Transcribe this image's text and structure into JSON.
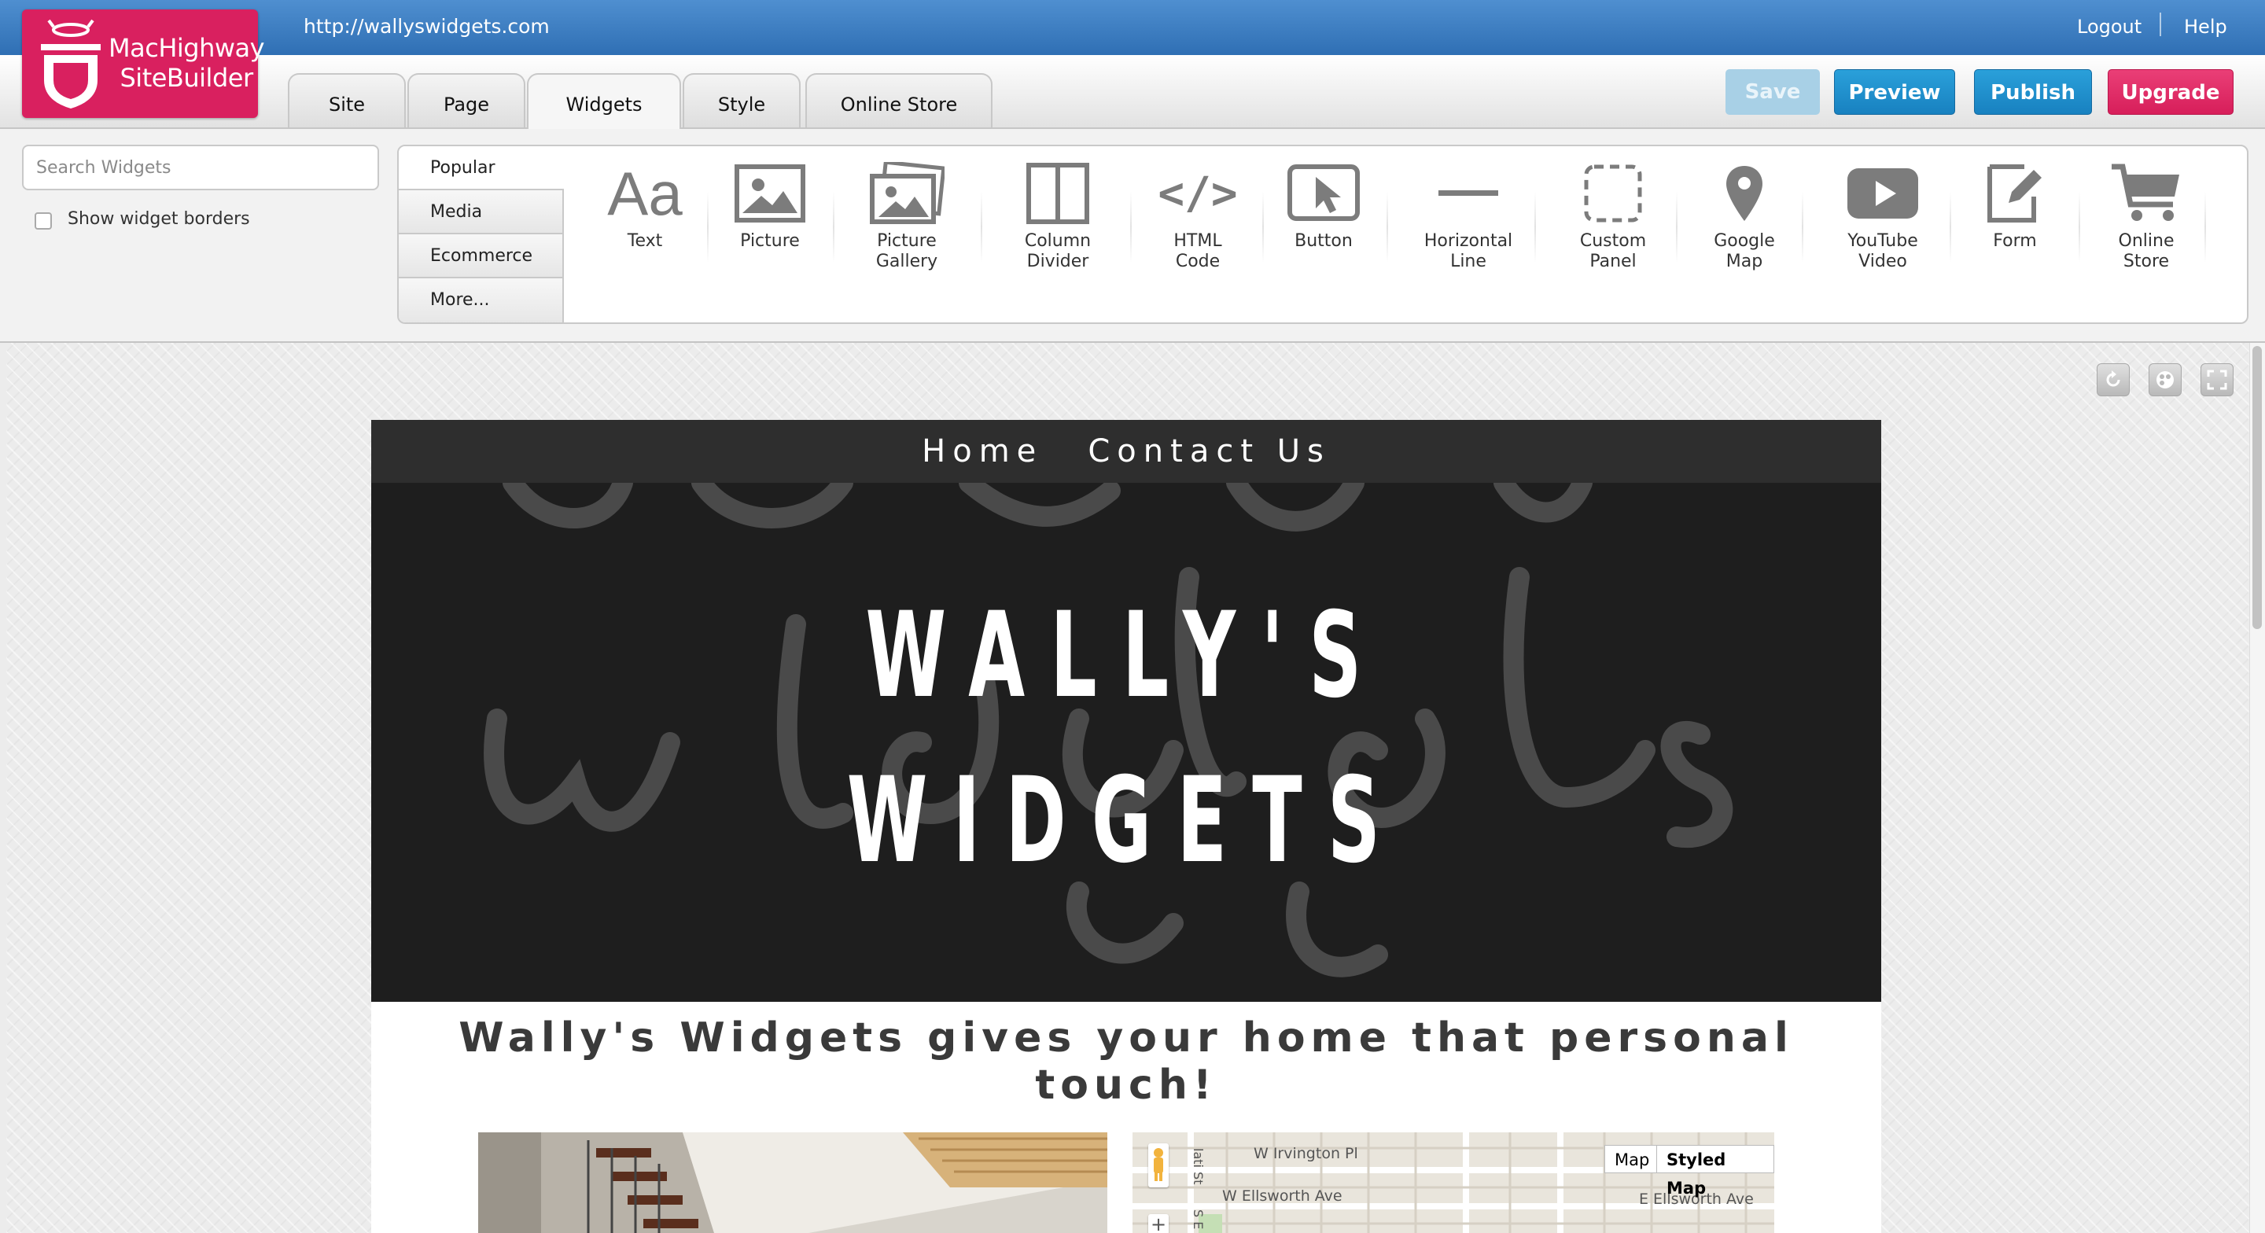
{
  "topbar": {
    "url": "http://wallyswidgets.com",
    "logout": "Logout",
    "help": "Help"
  },
  "logo": {
    "line1": "MacHighway",
    "line2": "SiteBuilder"
  },
  "tabs": [
    "Site",
    "Page",
    "Widgets",
    "Style",
    "Online Store"
  ],
  "active_tab": "Widgets",
  "actions": {
    "save": "Save",
    "preview": "Preview",
    "publish": "Publish",
    "upgrade": "Upgrade"
  },
  "widget_panel": {
    "search_placeholder": "Search Widgets",
    "show_borders": "Show widget borders",
    "categories": [
      "Popular",
      "Media",
      "Ecommerce",
      "More..."
    ],
    "active_category": "Popular",
    "widgets": [
      {
        "label": "Text",
        "icon": "text-icon"
      },
      {
        "label": "Picture",
        "icon": "picture-icon"
      },
      {
        "label": "Picture\nGallery",
        "icon": "gallery-icon"
      },
      {
        "label": "Column\nDivider",
        "icon": "column-divider-icon"
      },
      {
        "label": "HTML\nCode",
        "icon": "code-icon"
      },
      {
        "label": "Button",
        "icon": "cursor-icon"
      },
      {
        "label": "Horizontal\nLine",
        "icon": "horizontal-line-icon"
      },
      {
        "label": "Custom\nPanel",
        "icon": "custom-panel-icon"
      },
      {
        "label": "Google\nMap",
        "icon": "map-pin-icon"
      },
      {
        "label": "YouTube\nVideo",
        "icon": "youtube-icon"
      },
      {
        "label": "Form",
        "icon": "form-icon"
      },
      {
        "label": "Online\nStore",
        "icon": "cart-icon"
      }
    ],
    "text_icon_glyph": "Aa",
    "code_icon_glyph": "</>"
  },
  "site": {
    "nav": [
      "Home",
      "Contact Us"
    ],
    "hero_title_line1": "WALLY'S",
    "hero_title_line2": "WIDGETS",
    "tagline": "Wally's Widgets gives your home that personal touch!",
    "map": {
      "buttons": [
        "Map",
        "Styled Map"
      ],
      "streets": [
        "W Irvington Pl",
        "W Ellsworth Ave",
        "E Ellsworth Ave",
        "lati St",
        "S E"
      ],
      "zoom_in": "+"
    }
  },
  "colors": {
    "brand": "#d9205f",
    "accent_blue": "#1e8fcf",
    "hero_bg": "#1e1e1e"
  }
}
